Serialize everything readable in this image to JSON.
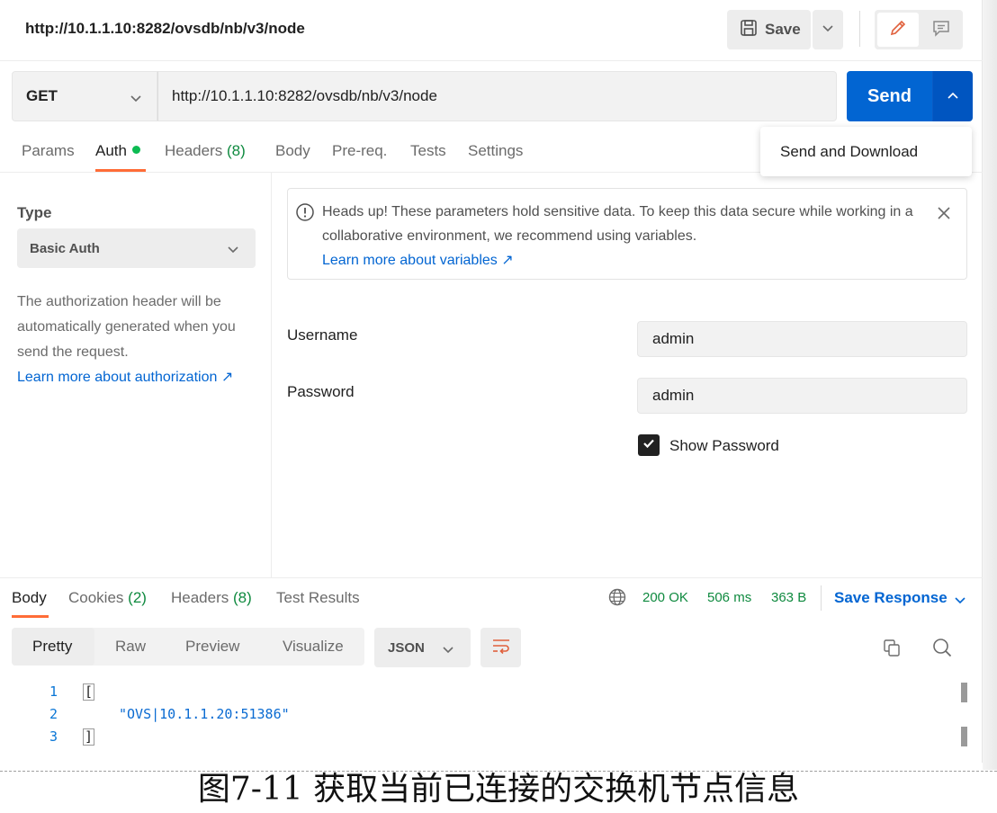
{
  "request": {
    "title": "http://10.1.1.10:8282/ovsdb/nb/v3/node",
    "save_label": "Save",
    "method": "GET",
    "url": "http://10.1.1.10:8282/ovsdb/nb/v3/node",
    "send_label": "Send",
    "send_menu_item": "Send and Download"
  },
  "request_tabs": {
    "params": "Params",
    "auth": "Auth",
    "headers": "Headers",
    "headers_count": "(8)",
    "body": "Body",
    "prereq": "Pre-req.",
    "tests": "Tests",
    "settings": "Settings",
    "active": "Auth"
  },
  "auth": {
    "type_label": "Type",
    "type_value": "Basic Auth",
    "description": "The authorization header will be automatically generated when you send the request.",
    "learn_more": "Learn more about authorization ↗",
    "notice_text": "Heads up! These parameters hold sensitive data. To keep this data secure while working in a collaborative environment, we recommend using variables.",
    "notice_link": "Learn more about variables ↗",
    "username_label": "Username",
    "username_value": "admin",
    "password_label": "Password",
    "password_value": "admin",
    "show_password_label": "Show Password",
    "show_password_checked": true
  },
  "response_tabs": {
    "body": "Body",
    "cookies": "Cookies",
    "cookies_count": "(2)",
    "headers": "Headers",
    "headers_count": "(8)",
    "test_results": "Test Results",
    "active": "Body"
  },
  "response_status": {
    "status": "200 OK",
    "time": "506 ms",
    "size": "363 B",
    "save_response": "Save Response"
  },
  "view": {
    "tabs": [
      "Pretty",
      "Raw",
      "Preview",
      "Visualize"
    ],
    "active": "Pretty",
    "format": "JSON"
  },
  "code_lines": [
    {
      "num": "1",
      "text": "["
    },
    {
      "num": "2",
      "text": "\"OVS|10.1.1.20:51386\""
    },
    {
      "num": "3",
      "text": "]"
    }
  ],
  "caption": "图7-11  获取当前已连接的交换机节点信息",
  "colors": {
    "accent": "#ff6c37",
    "primary": "#0265d2",
    "success": "#0f8a3f"
  },
  "icons": [
    "save-icon",
    "chevron-down-icon",
    "pencil-icon",
    "comment-icon",
    "chevron-up-icon",
    "info-icon",
    "close-icon",
    "check-icon",
    "globe-icon",
    "wrap-lines-icon",
    "copy-icon",
    "search-icon"
  ]
}
